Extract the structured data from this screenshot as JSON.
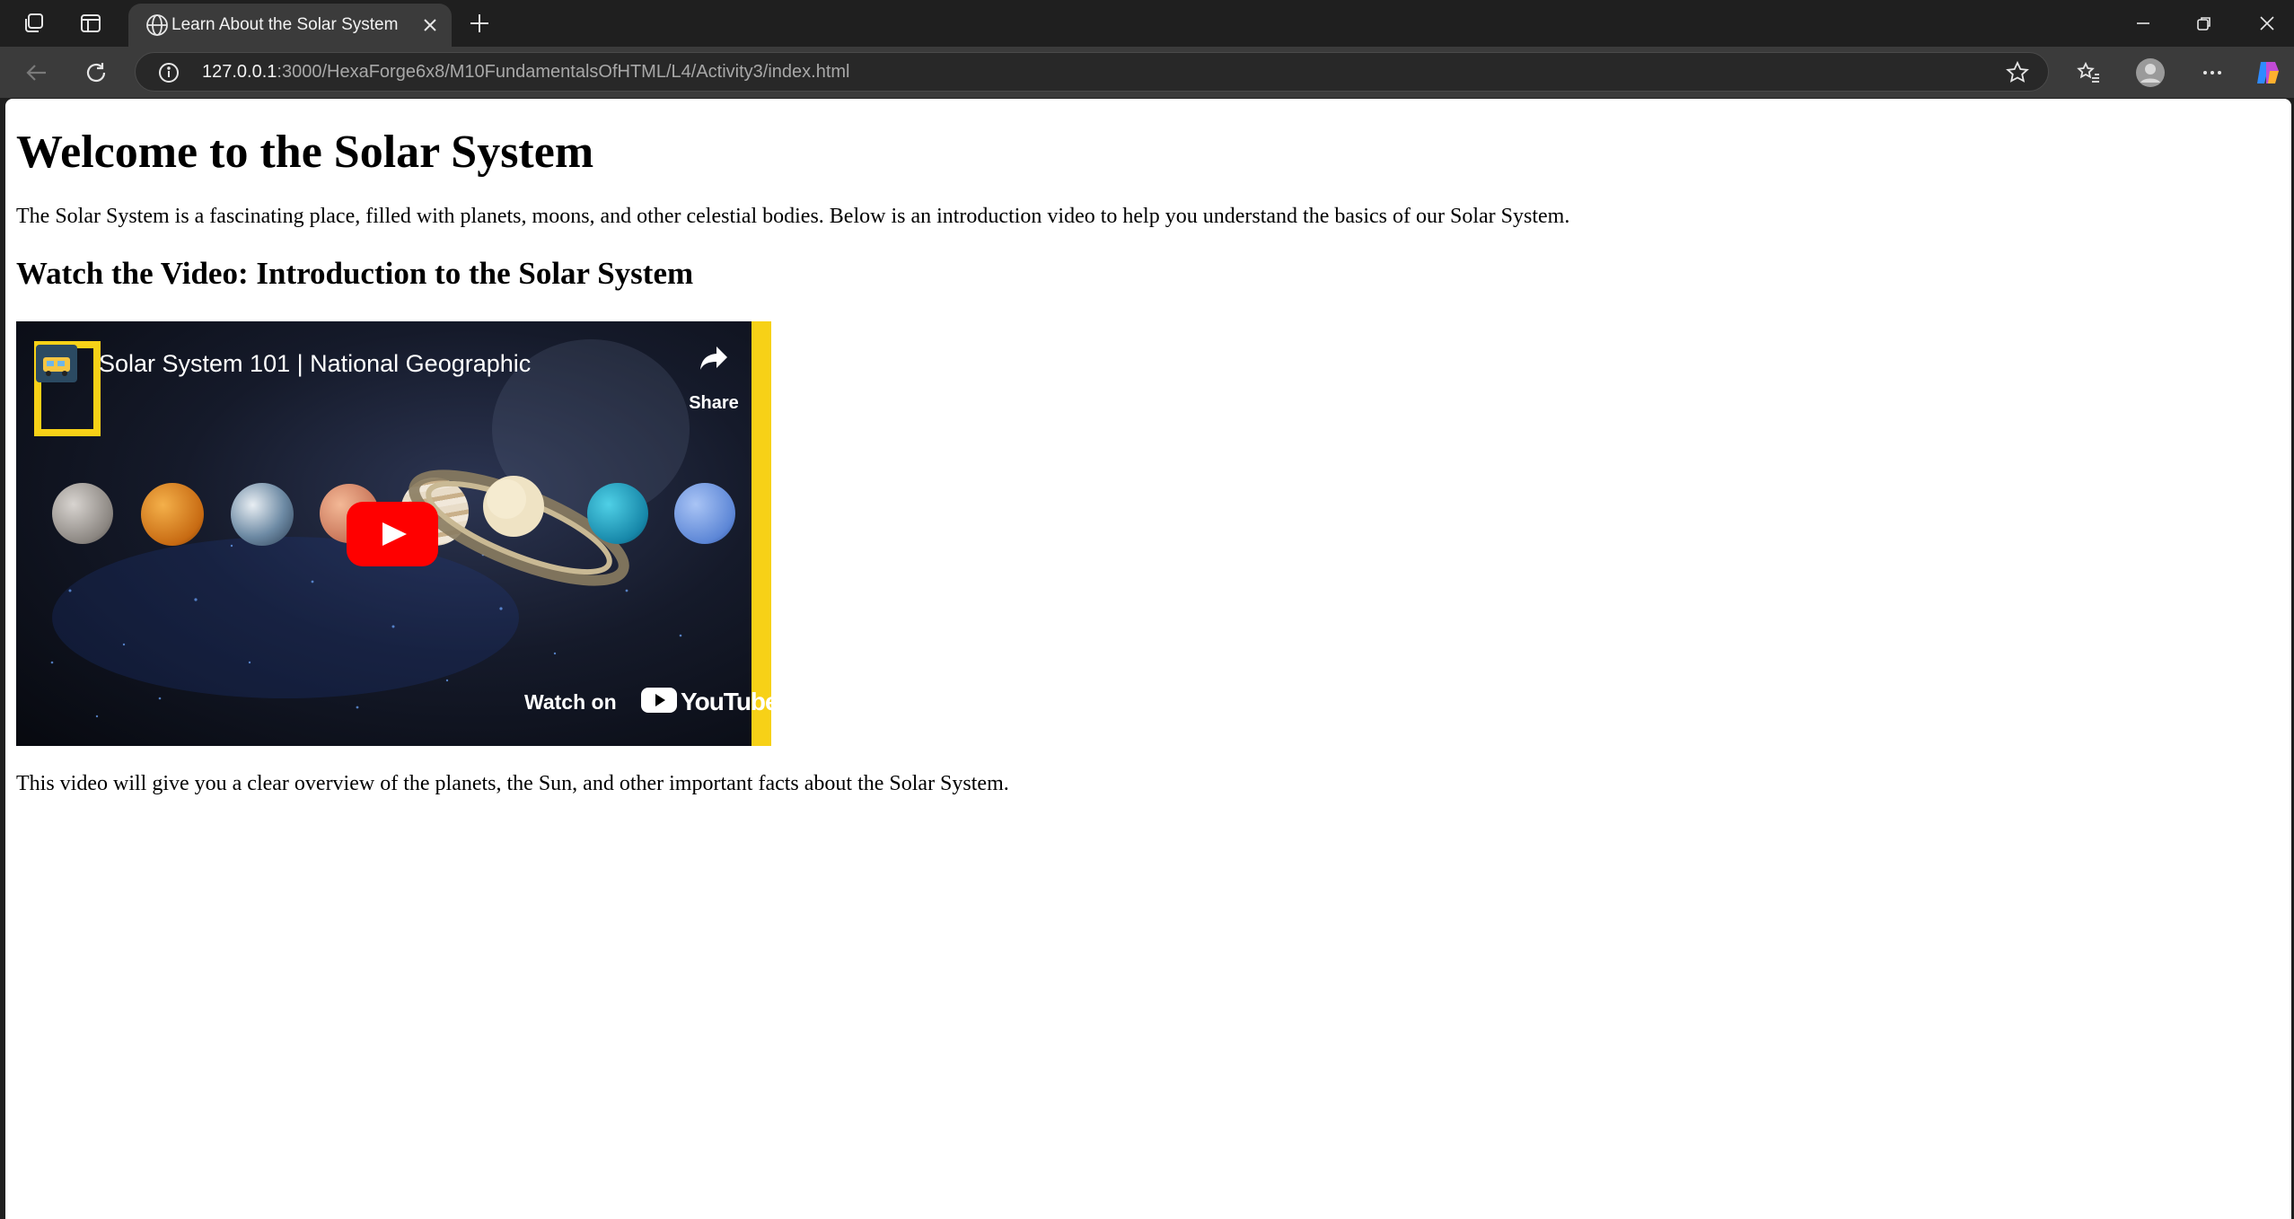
{
  "browser": {
    "tab_title": "Learn About the Solar System",
    "url_host": "127.0.0.1",
    "url_path": ":3000/HexaForge6x8/M10FundamentalsOfHTML/L4/Activity3/index.html"
  },
  "page": {
    "heading": "Welcome to the Solar System",
    "intro": "The Solar System is a fascinating place, filled with planets, moons, and other celestial bodies. Below is an introduction video to help you understand the basics of our Solar System.",
    "video_heading": "Watch the Video: Introduction to the Solar System",
    "outro": "This video will give you a clear overview of the planets, the Sun, and other important facts about the Solar System."
  },
  "video": {
    "title": "Solar System 101 | National Geographic",
    "share_label": "Share",
    "watch_on_label": "Watch on",
    "youtube_wordmark": "YouTube",
    "accent_color": "#f7d117",
    "play_color": "#ff0000"
  }
}
